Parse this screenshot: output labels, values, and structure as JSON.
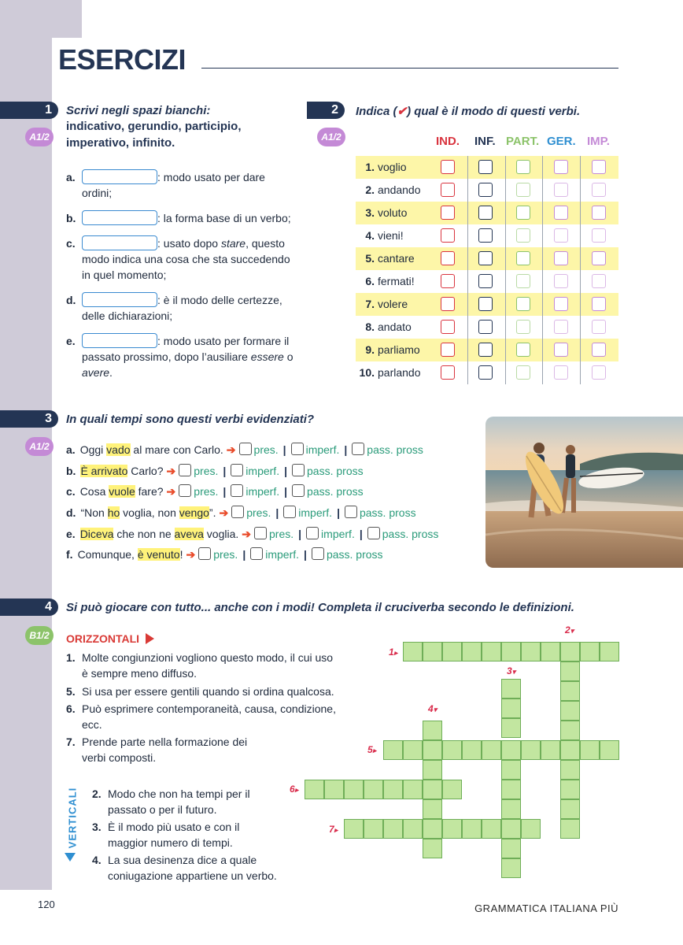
{
  "page": {
    "title": "ESERCIZI",
    "page_number": "120",
    "book_title": "GRAMMATICA ITALIANA PIÙ"
  },
  "colors": {
    "navy": "#243554",
    "lavender": "#cfcbd8",
    "level_a": "#c48ad6",
    "level_b": "#8cc36a",
    "highlight": "#fdf6a8",
    "green_options": "#2a9b7a",
    "red_arrow": "#e94b2a"
  },
  "ex1": {
    "number": "1",
    "level": "A1/2",
    "instruction_line1": "Scrivi negli spazi bianchi:",
    "instruction_line2": "indicativo, gerundio, participio,",
    "instruction_line3": "imperativo, infinito.",
    "items": [
      {
        "letter": "a.",
        "text": ": modo usato per dare",
        "text2": "ordini;"
      },
      {
        "letter": "b.",
        "text": ": la forma base di un verbo;"
      },
      {
        "letter": "c.",
        "text": ": usato dopo ",
        "italic": "stare",
        "text_after": ", questo",
        "text2": "modo indica una cosa che sta succedendo",
        "text3": "in quel momento;"
      },
      {
        "letter": "d.",
        "text": ": è il modo delle certezze,",
        "text2": "delle dichiarazioni;"
      },
      {
        "letter": "e.",
        "text": ": modo usato per formare il",
        "text2a": "passato prossimo, dopo l’ausiliare ",
        "text2_italic": "essere",
        "text2b": " o",
        "text3_italic": "avere",
        "text3b": "."
      }
    ]
  },
  "ex2": {
    "number": "2",
    "level": "A1/2",
    "instruction_before": "Indica (",
    "check_mark": "✔",
    "instruction_after": ") qual è il modo di questi verbi.",
    "headers": [
      "IND.",
      "INF.",
      "PART.",
      "GER.",
      "IMP."
    ],
    "header_colors": [
      "#d9343f",
      "#243554",
      "#8cc36a",
      "#2f8fd1",
      "#c48ad6"
    ],
    "rows": [
      {
        "n": "1.",
        "verb": "voglio"
      },
      {
        "n": "2.",
        "verb": "andando"
      },
      {
        "n": "3.",
        "verb": "voluto"
      },
      {
        "n": "4.",
        "verb": "vieni!"
      },
      {
        "n": "5.",
        "verb": "cantare"
      },
      {
        "n": "6.",
        "verb": "fermati!"
      },
      {
        "n": "7.",
        "verb": "volere"
      },
      {
        "n": "8.",
        "verb": "andato"
      },
      {
        "n": "9.",
        "verb": "parliamo"
      },
      {
        "n": "10.",
        "verb": "parlando"
      }
    ]
  },
  "ex3": {
    "number": "3",
    "level": "A1/2",
    "instruction": "In quali tempi sono questi verbi evidenziati?",
    "options": [
      "pres.",
      "imperf.",
      "pass. pross"
    ],
    "sentences": [
      {
        "letter": "a.",
        "parts": [
          [
            "Oggi ",
            false
          ],
          [
            "vado",
            true
          ],
          [
            " al mare con Carlo.",
            false
          ]
        ]
      },
      {
        "letter": "b.",
        "parts": [
          [
            "È arrivato",
            true
          ],
          [
            " Carlo?",
            false
          ]
        ]
      },
      {
        "letter": "c.",
        "parts": [
          [
            "Cosa ",
            false
          ],
          [
            "vuole",
            true
          ],
          [
            " fare?",
            false
          ]
        ]
      },
      {
        "letter": "d.",
        "parts": [
          [
            "“Non ",
            false
          ],
          [
            "ho",
            true
          ],
          [
            " voglia, non ",
            false
          ],
          [
            "vengo",
            true
          ],
          [
            "”.",
            false
          ]
        ]
      },
      {
        "letter": "e.",
        "parts": [
          [
            "Diceva",
            true
          ],
          [
            " che non ne ",
            false
          ],
          [
            "aveva",
            true
          ],
          [
            " voglia.",
            false
          ]
        ]
      },
      {
        "letter": "f.",
        "parts": [
          [
            "Comunque, ",
            false
          ],
          [
            "è venuto",
            true
          ],
          [
            "!",
            false
          ]
        ]
      }
    ]
  },
  "ex4": {
    "number": "4",
    "level": "B1/2",
    "instruction": "Si può giocare con tutto... anche con i modi! Completa il cruciverba secondo le definizioni.",
    "orizzontali_label": "ORIZZONTALI",
    "verticali_label": "VERTICALI",
    "orizzontali": [
      {
        "n": "1.",
        "l1": "Molte congiunzioni vogliono questo modo, il cui uso",
        "l2": "è sempre meno diffuso."
      },
      {
        "n": "5.",
        "l1": "Si usa per essere gentili quando si ordina qualcosa."
      },
      {
        "n": "6.",
        "l1": "Può esprimere contemporaneità, causa, condizione,",
        "l2": "ecc."
      },
      {
        "n": "7.",
        "l1": "Prende parte nella formazione dei",
        "l2": "verbi composti."
      }
    ],
    "verticali": [
      {
        "n": "2.",
        "l1": "Modo che non ha tempi per il",
        "l2": "passato o per il futuro."
      },
      {
        "n": "3.",
        "l1": "È il modo più usato e con il",
        "l2": "maggior numero di tempi."
      },
      {
        "n": "4.",
        "l1": "La sua desinenza dice a quale",
        "l2": "coniugazione appartiene un verbo."
      }
    ],
    "crossword_numbers": [
      "1",
      "2",
      "3",
      "4",
      "5",
      "6",
      "7"
    ]
  }
}
